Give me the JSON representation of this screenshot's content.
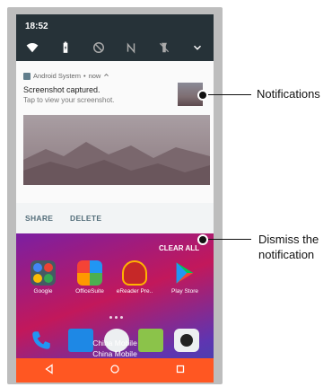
{
  "status_bar": {
    "time": "18:52"
  },
  "quick_settings": {
    "icons": [
      "wifi-icon",
      "battery-icon",
      "do-not-disturb-icon",
      "mobile-data-off-icon",
      "flashlight-icon",
      "expand-chevron-icon"
    ]
  },
  "notification": {
    "app_name": "Android System",
    "separator": "•",
    "time": "now",
    "title": "Screenshot captured.",
    "body": "Tap to view your screenshot.",
    "actions": {
      "share": "SHARE",
      "delete": "DELETE"
    }
  },
  "home": {
    "clear_all": "CLEAR ALL",
    "apps": [
      {
        "label": "Google",
        "icon": "google-folder-icon"
      },
      {
        "label": "OfficeSuite",
        "icon": "officesuite-icon"
      },
      {
        "label": "eReader Pre..",
        "icon": "ereader-icon"
      },
      {
        "label": "Play Store",
        "icon": "play-store-icon"
      }
    ],
    "carrier_lines": [
      "China Mobile",
      "China Mobile"
    ]
  },
  "navbar": {
    "icons": [
      "back-icon",
      "home-icon",
      "recents-icon"
    ]
  },
  "callouts": {
    "notifications": "Notifications",
    "dismiss": "Dismiss the notification"
  },
  "colors": {
    "qs_background": "#263238",
    "navbar": "#ff5722",
    "action_text": "#546e7a"
  }
}
